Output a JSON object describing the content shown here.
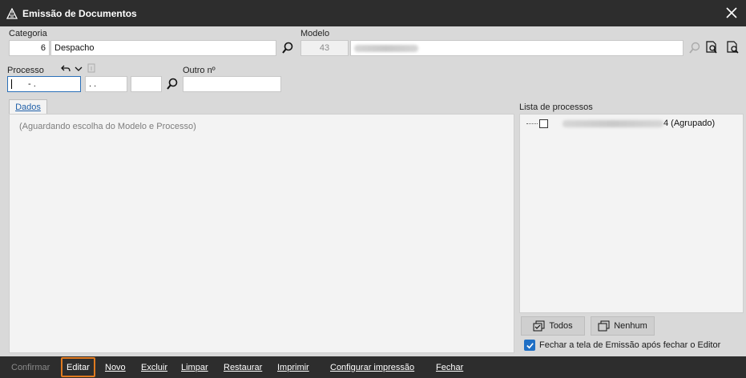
{
  "window": {
    "title": "Emissão de Documentos"
  },
  "categoria": {
    "label": "Categoria",
    "code": "6",
    "name": "Despacho"
  },
  "modelo": {
    "label": "Modelo",
    "code": "43"
  },
  "processo": {
    "label": "Processo",
    "part1": "- .",
    "part2": ". ."
  },
  "outro": {
    "label": "Outro nº"
  },
  "tabs": [
    {
      "label": "Dados"
    }
  ],
  "dados": {
    "hint": "(Aguardando escolha do Modelo e Processo)"
  },
  "lista": {
    "label": "Lista de processos",
    "items": [
      {
        "suffix": "4 (Agrupado)",
        "checked": false
      }
    ]
  },
  "buttons": {
    "todos": "Todos",
    "nenhum": "Nenhum"
  },
  "fechar_checkbox": {
    "label": "Fechar a tela de Emissão após fechar o Editor",
    "checked": true
  },
  "bottombar": {
    "confirmar": "Confirmar",
    "editar": "Editar",
    "novo": "Novo",
    "excluir": "Excluir",
    "limpar": "Limpar",
    "restaurar": "Restaurar",
    "imprimir": "Imprimir",
    "configurar": "Configurar impressão",
    "fechar": "Fechar"
  },
  "colors": {
    "titlebar": "#2d2d2d",
    "accent": "#1f6fc5",
    "selected_outline": "#e07a1f"
  }
}
